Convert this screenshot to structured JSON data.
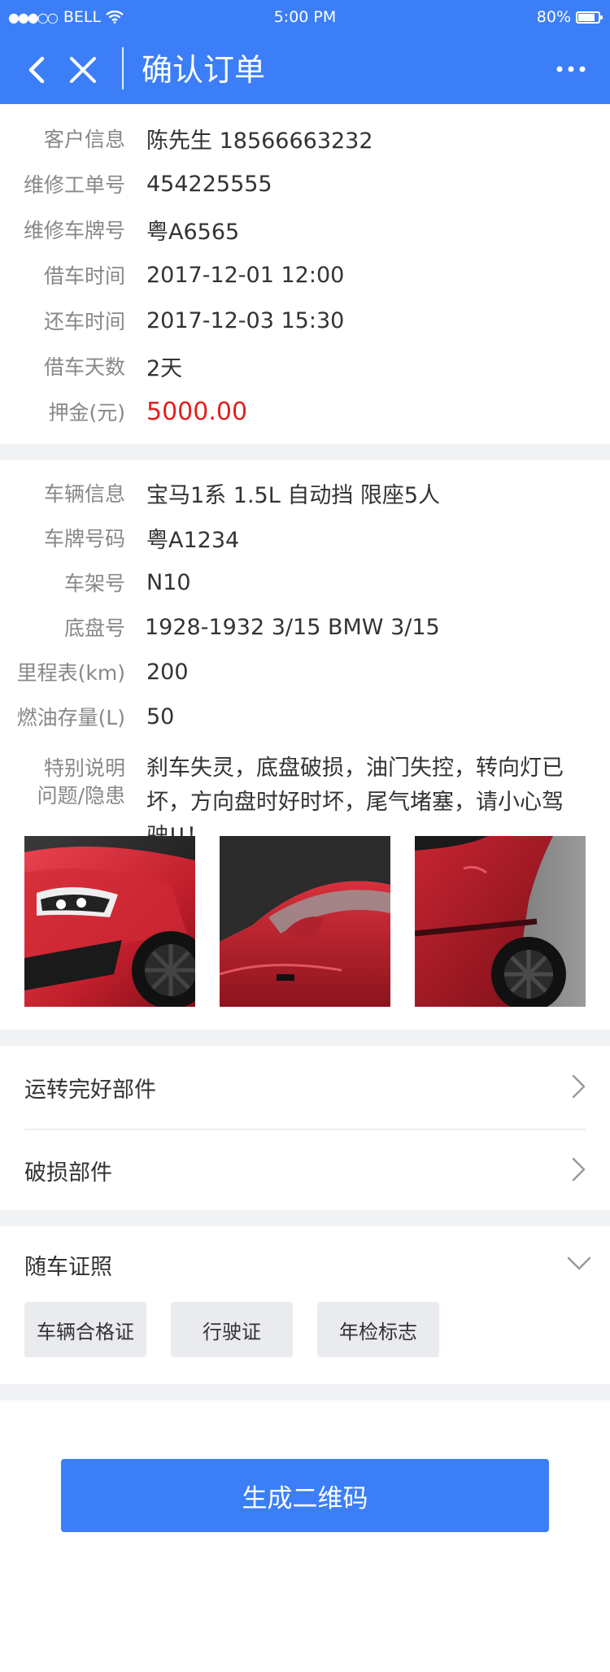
{
  "status_bar": {
    "signal": "●●●○○",
    "carrier": "BELL",
    "time": "5:00 PM",
    "battery": "80%"
  },
  "nav": {
    "title": "确认订单"
  },
  "order_info": [
    {
      "label": "客户信息",
      "value": "陈先生  18566663232"
    },
    {
      "label": "维修工单号",
      "value": "454225555"
    },
    {
      "label": "维修车牌号",
      "value": "粤A6565"
    },
    {
      "label": "借车时间",
      "value": "2017-12-01 12:00"
    },
    {
      "label": "还车时间",
      "value": "2017-12-03 15:30"
    },
    {
      "label": "借车天数",
      "value": "2天"
    },
    {
      "label": "押金(元)",
      "value": "5000.00"
    }
  ],
  "vehicle_info": [
    {
      "label": "车辆信息",
      "value": "宝马1系  1.5L  自动挡  限座5人"
    },
    {
      "label": "车牌号码",
      "value": "粤A1234"
    },
    {
      "label": "车架号",
      "value": "N10"
    },
    {
      "label": "底盘号",
      "value": "1928-1932 3/15 BMW 3/15"
    },
    {
      "label": "里程表(km)",
      "value": "200"
    },
    {
      "label": "燃油存量(L)",
      "value": "50"
    }
  ],
  "special_note": {
    "label_line1": "特别说明",
    "label_line2": "问题/隐患",
    "text": "刹车失灵，底盘破损，油门失控，转向灯已坏，方向盘时好时坏，尾气堵塞，请小心驾驶!!！"
  },
  "menu": {
    "good_parts": "运转完好部件",
    "damaged_parts": "破损部件",
    "documents": "随车证照"
  },
  "documents": [
    "车辆合格证",
    "行驶证",
    "年检标志"
  ],
  "actions": {
    "generate_qr": "生成二维码"
  },
  "colors": {
    "primary": "#3b7ef7",
    "deposit": "#e0201c",
    "tag_bg": "#e9ebee",
    "section_gap": "#f1f2f4"
  },
  "icons": {
    "back": "chevron-left-icon",
    "close": "close-icon",
    "more": "more-dots-icon",
    "row_arrow": "chevron-right-icon",
    "expand": "chevron-down-icon",
    "wifi": "wifi-icon",
    "battery": "battery-icon"
  }
}
